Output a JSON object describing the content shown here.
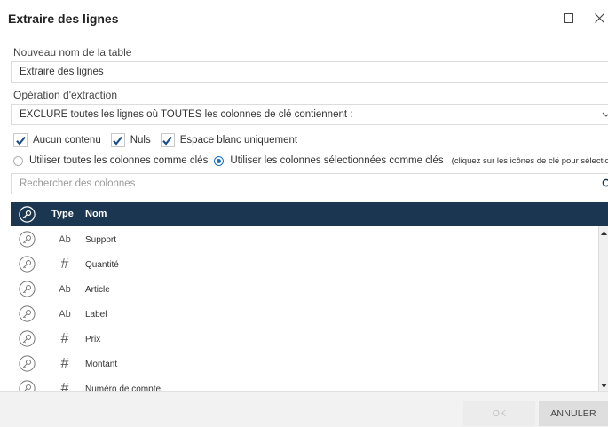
{
  "dialog": {
    "title": "Extraire des lignes",
    "maximize_icon": "maximize-icon",
    "close_icon": "close-icon"
  },
  "table_name": {
    "label": "Nouveau nom de la table",
    "value": "Extraire des lignes"
  },
  "operation": {
    "label": "Opération d'extraction",
    "selected": "EXCLURE toutes les lignes où TOUTES les colonnes de clé contiennent :"
  },
  "conditions": [
    {
      "label": "Aucun contenu",
      "checked": true
    },
    {
      "label": "Nuls",
      "checked": true
    },
    {
      "label": "Espace blanc uniquement",
      "checked": true
    }
  ],
  "key_mode": {
    "options": [
      {
        "label": "Utiliser toutes les colonnes comme clés",
        "selected": false
      },
      {
        "label": "Utiliser les colonnes sélectionnées comme clés",
        "selected": true
      }
    ],
    "hint": "(cliquez sur les icônes de clé pour sélectionner)"
  },
  "search": {
    "placeholder": "Rechercher des colonnes",
    "icon": "search-icon"
  },
  "columns_grid": {
    "headers": {
      "key": "key-icon",
      "type": "Type",
      "name": "Nom"
    },
    "rows": [
      {
        "type": "Ab",
        "name": "Support"
      },
      {
        "type": "#",
        "name": "Quantité"
      },
      {
        "type": "Ab",
        "name": "Article"
      },
      {
        "type": "Ab",
        "name": "Label"
      },
      {
        "type": "#",
        "name": "Prix"
      },
      {
        "type": "#",
        "name": "Montant"
      },
      {
        "type": "#",
        "name": "Numéro de compte"
      }
    ]
  },
  "footer": {
    "ok_label": "OK",
    "ok_enabled": false,
    "cancel_label": "ANNULER"
  },
  "colors": {
    "header_bg": "#1a3650",
    "check_color": "#1d4f8a",
    "radio_accent": "#1a6fbf"
  }
}
